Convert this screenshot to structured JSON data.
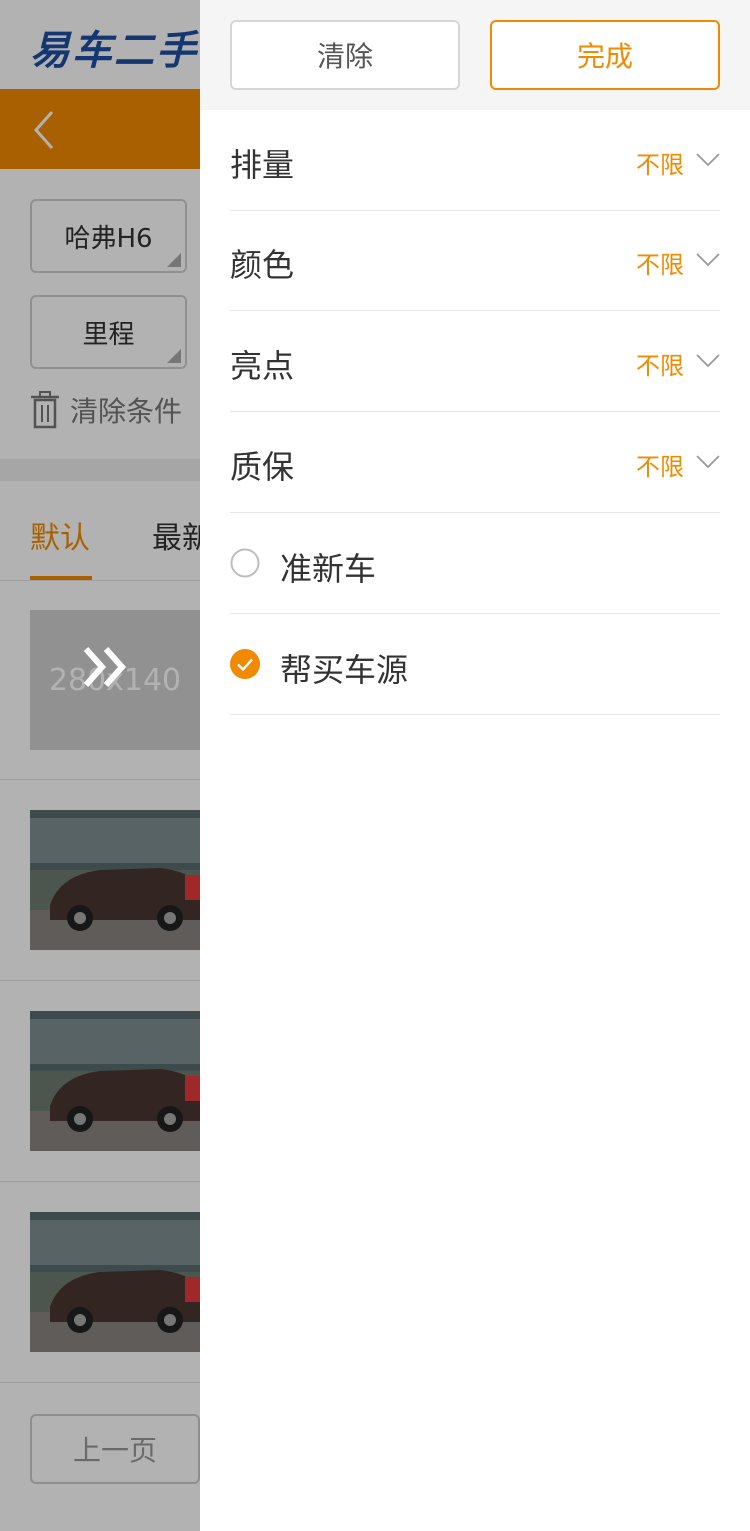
{
  "background": {
    "logo_text": "易车二手",
    "chips": [
      "哈弗H6",
      "里程"
    ],
    "clear_conditions": "清除条件",
    "sort_tabs": [
      "默认",
      "最新"
    ],
    "placeholder_text": "280x140",
    "prev_page": "上一页"
  },
  "drawer": {
    "clear_label": "清除",
    "done_label": "完成",
    "filters": [
      {
        "label": "排量",
        "value": "不限"
      },
      {
        "label": "颜色",
        "value": "不限"
      },
      {
        "label": "亮点",
        "value": "不限"
      },
      {
        "label": "质保",
        "value": "不限"
      }
    ],
    "options": [
      {
        "label": "准新车",
        "checked": false
      },
      {
        "label": "帮买车源",
        "checked": true
      }
    ]
  },
  "colors": {
    "accent": "#f18a00",
    "brand_blue": "#1d4fa3",
    "text": "#333333"
  }
}
